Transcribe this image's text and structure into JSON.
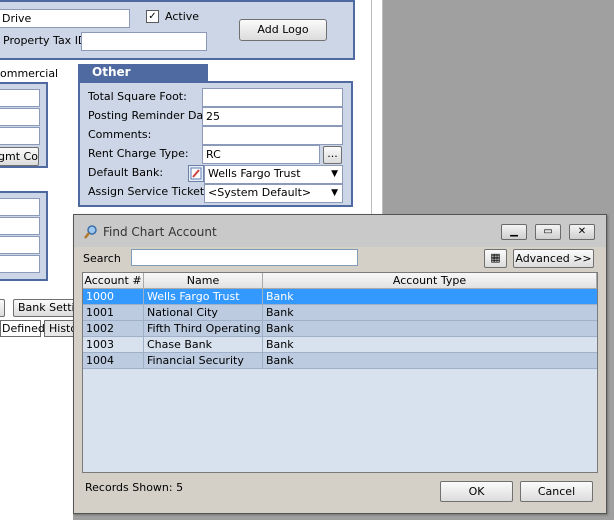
{
  "form": {
    "address_value": "Drive",
    "active_label": "Active",
    "active_checked": "✓",
    "add_logo_label": "Add Logo",
    "property_tax_label": "Property Tax ID:",
    "commercial_label": "ommercial",
    "mgmt_button_label": "gmt Co.",
    "bank_settings_label": "Bank Settin",
    "tab_defined": "Defined",
    "tab_history": "Histo"
  },
  "other_info": {
    "title": "Other Information",
    "total_sq_ft_label": "Total Square Foot:",
    "total_sq_ft_value": "",
    "posting_reminder_label": "Posting Reminder Day:",
    "posting_reminder_value": "25",
    "comments_label": "Comments:",
    "comments_value": "",
    "rent_charge_label": "Rent Charge Type:",
    "rent_charge_value": "RC",
    "ellipsis": "...",
    "default_bank_label": "Default Bank:",
    "default_bank_value": "Wells Fargo Trust",
    "assign_tickets_label": "Assign Service Tickets:",
    "assign_tickets_value": "<System Default>"
  },
  "dialog": {
    "title": "Find Chart Account",
    "search_label": "Search",
    "search_value": "",
    "advanced_label": "Advanced >>",
    "columns": [
      "Account #",
      "Name",
      "Account Type"
    ],
    "rows": [
      {
        "account": "1000",
        "name": "Wells Fargo Trust",
        "type": "Bank",
        "selected": true
      },
      {
        "account": "1001",
        "name": "National City",
        "type": "Bank"
      },
      {
        "account": "1002",
        "name": "Fifth Third Operating",
        "type": "Bank"
      },
      {
        "account": "1003",
        "name": "Chase Bank",
        "type": "Bank"
      },
      {
        "account": "1004",
        "name": "Financial Security",
        "type": "Bank"
      }
    ],
    "records_shown": "Records Shown: 5",
    "ok_label": "OK",
    "cancel_label": "Cancel"
  },
  "colors": {
    "panel_blue": "#4f6aa0",
    "panel_fill": "#cdd6e6",
    "selection": "#3399ff"
  }
}
